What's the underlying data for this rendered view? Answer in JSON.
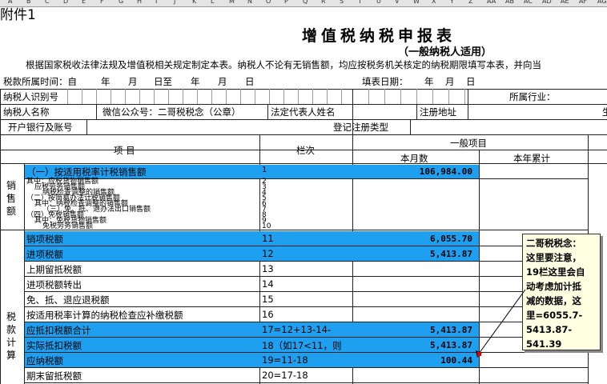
{
  "sheet": {
    "column_letters": [
      "A",
      "B",
      "C",
      "D",
      "E",
      "F",
      "G",
      "H",
      "I",
      "J",
      "K",
      "L",
      "M",
      "N",
      "O",
      "P",
      "Q",
      "R",
      "S",
      "T",
      "U",
      "V",
      "W",
      "X",
      "Y",
      "Z",
      "AA",
      "AB",
      "AC",
      "AD",
      "AE",
      "AF",
      "AG"
    ],
    "attachment_label": "附件1",
    "title": "增值税纳税申报表",
    "subtitle": "（一般纳税人适用）",
    "intro": "根据国家税收法律法规及增值税相关规定制定本表。纳税人不论有无销售额，均应按税务机关核定的纳税期限填写本表，并向当",
    "period": {
      "label": "税款所属时间：自",
      "year": "年",
      "month": "月",
      "day_from": "日至",
      "year2": "年",
      "month2": "月",
      "day2": "日",
      "fill_date": "填表日期：",
      "fy": "年",
      "fm": "月",
      "fd": "日"
    },
    "taxpayer_id_label": "纳税人识别号",
    "industry_label": "所属行业：",
    "taxpayer_name_label": "纳税人名称",
    "taxpayer_name_value": "微信公众号：二哥税税念（公章）",
    "legal_rep_label": "法定代表人姓名",
    "reg_addr_label": "注册地址",
    "cut_label": "生",
    "bank_label": "开户银行及账号",
    "reg_type_label": "登记注册类型",
    "header": {
      "item": "项  目",
      "line": "栏次",
      "general": "一般项目",
      "this_month": "本月数",
      "ytd": "本年累计"
    },
    "groups": {
      "sales": "销售额",
      "tax": "税款计算"
    },
    "rows_sales": [
      {
        "label": "（一）按适用税率计税销售额",
        "line": "1",
        "value": "106,984.00",
        "hl": true
      }
    ],
    "collapsed_rows": {
      "labels": [
        "其中：应税货物销售额",
        "应税劳务销售额",
        "纳税检查调整的销售额",
        "（二）按简易办法计税销售额",
        "其中：纳税检查调整的销售额",
        "（三）免、抵、退办法出口销售额",
        "（四）免税销售额",
        "其中：免税货物销售额",
        "免税劳务销售额"
      ],
      "lines": [
        "2",
        "3",
        "4",
        "5",
        "6",
        "7",
        "8",
        "9",
        "10"
      ]
    },
    "rows_tax": [
      {
        "label": "销项税额",
        "line": "11",
        "value": "6,055.70",
        "hl": true
      },
      {
        "label": "进项税额",
        "line": "12",
        "value": "5,413.87",
        "hl": true
      },
      {
        "label": "上期留抵税额",
        "line": "13",
        "value": "",
        "hl": false
      },
      {
        "label": "进项税额转出",
        "line": "14",
        "value": "",
        "hl": false
      },
      {
        "label": "免、抵、退应退税额",
        "line": "15",
        "value": "",
        "hl": false
      },
      {
        "label": "按适用税率计算的纳税检查应补缴税额",
        "line": "16",
        "value": "",
        "hl": false
      },
      {
        "label": "应抵扣税额合计",
        "line": "17=12+13-14-",
        "value": "5,413.87",
        "hl": true
      },
      {
        "label": "实际抵扣税额",
        "line": "18（如17<11，则",
        "value": "5,413.87",
        "hl": true
      },
      {
        "label": "应纳税额",
        "line": "19=11-18",
        "value": "100.44",
        "hl": true
      },
      {
        "label": "期末留抵税额",
        "line": "20=17-18",
        "value": "",
        "hl": false
      }
    ],
    "comment": {
      "lines": [
        "二哥税税念：",
        "这里要注意，",
        "19栏这里会自",
        "动考虑加计抵",
        "减的数据，这",
        "里=6055.7-",
        "5413.87-",
        "541.39"
      ]
    },
    "colors": {
      "highlight": "#1e9ff0",
      "comment_bg": "#ffffe1",
      "grid": "#222222"
    }
  }
}
